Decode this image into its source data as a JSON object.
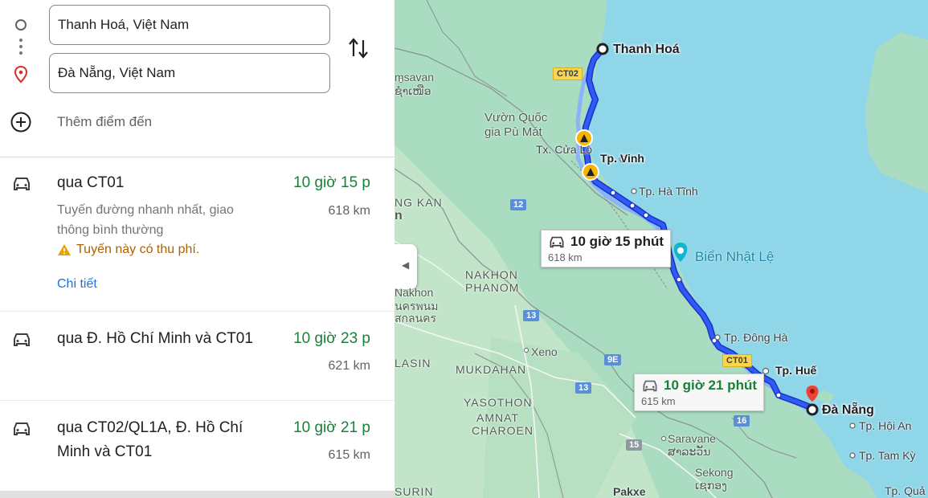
{
  "directions": {
    "origin": "Thanh Hoá, Việt Nam",
    "destination": "Đà Nẵng, Việt Nam",
    "add_destination": "Thêm điểm đến"
  },
  "routes": [
    {
      "via": "qua CT01",
      "duration": "10 giờ 15 p",
      "distance": "618 km",
      "description": "Tuyến đường nhanh nhất, giao thông bình thường",
      "warning": "Tuyến này có thu phí.",
      "details_link": "Chi tiết"
    },
    {
      "via": "qua Đ. Hồ Chí Minh và CT01",
      "duration": "10 giờ 23 p",
      "distance": "621 km"
    },
    {
      "via": "qua CT02/QL1A, Đ. Hồ Chí Minh và CT01",
      "duration": "10 giờ 21 p",
      "distance": "615 km"
    }
  ],
  "map": {
    "cities": {
      "origin": "Thanh Hoá",
      "vinh": "Tp. Vinh",
      "ha_tinh": "Tp. Hà Tĩnh",
      "dong_ha": "Tp. Đông Hà",
      "hue": "Tp. Huế",
      "destination": "Đà Nẵng",
      "hoi_an": "Tp. Hội An",
      "tam_ky": "Tp. Tam Kỳ",
      "quang_ngai": "Tp. Quả",
      "cua_lo": "Tx. Cửa Lò"
    },
    "labels": {
      "vuon_quoc_gia_1": "Vườn Quốc",
      "vuon_quoc_gia_2": "gia Pù Mát",
      "xamsavan": "msavan",
      "lao_script_1": "ຊຳເໜືອ",
      "lao_script_2": "ສາລະວັນ",
      "lao_script_3": "ເຊກອງ",
      "thai_script": "นครพนม",
      "thai_script_2": "สกลนคร",
      "ng_kan": "NG KAN",
      "n_label": "n",
      "nakhon_phanom_1": "NAKHON",
      "nakhon_phanom_2": "PHANOM",
      "nakhon": "Nakhon",
      "xeno": "Xeno",
      "lasin": "LASIN",
      "mukdahan": "MUKDAHAN",
      "yasothon": "YASOTHON",
      "amnat_1": "AMNAT",
      "amnat_2": "CHAROEN",
      "saravane": "Saravane",
      "sekong": "Sekong",
      "pakxe": "Pakxe",
      "surin": "SURIN",
      "bien_nhat_le": "Biển Nhật Lệ"
    },
    "shields": {
      "ct02": "CT02",
      "ct01": "CT01",
      "r12": "12",
      "r13a": "13",
      "r13b": "13",
      "r9e": "9E",
      "r15": "15",
      "r16": "16"
    },
    "callouts": {
      "main_time": "10 giờ 15 phút",
      "main_dist": "618 km",
      "alt_time": "10 giờ 21 phút",
      "alt_dist": "615 km"
    },
    "colors": {
      "route": "#1a3ef0",
      "sea": "#8fd6e8",
      "land": "#a8dcc3"
    }
  }
}
